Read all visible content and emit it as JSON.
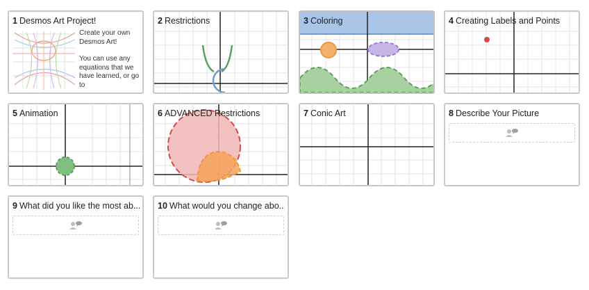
{
  "cards": [
    {
      "num": "1",
      "title": "Desmos Art Project!",
      "desc1": "Create your own Desmos Art!",
      "desc2": "You can use any equations that we have learned, or go to"
    },
    {
      "num": "2",
      "title": "Restrictions"
    },
    {
      "num": "3",
      "title": "Coloring"
    },
    {
      "num": "4",
      "title": "Creating Labels and Points"
    },
    {
      "num": "5",
      "title": "Animation"
    },
    {
      "num": "6",
      "title": "ADVANCED Restrictions"
    },
    {
      "num": "7",
      "title": "Conic Art"
    },
    {
      "num": "8",
      "title": "Describe Your Picture"
    },
    {
      "num": "9",
      "title": "What did you like the most ab..."
    },
    {
      "num": "10",
      "title": "What would you change abo..."
    }
  ],
  "icons": {
    "response": "response-bubble-icon"
  },
  "colors": {
    "grid": "#e3e3e3",
    "axis": "#222222",
    "green": "#5aa05a",
    "blue": "#6b9bd0",
    "orange": "#f0963c",
    "purple": "#9a7fd0",
    "red": "#d44a4a",
    "selected_band": "#a9c4e6"
  }
}
